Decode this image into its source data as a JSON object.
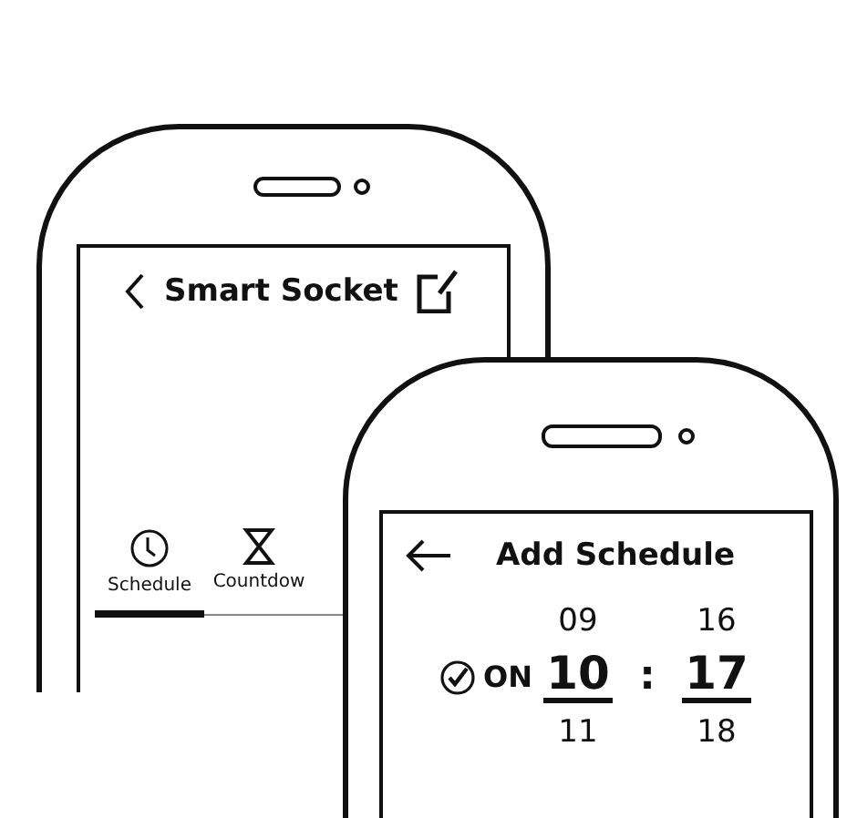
{
  "main_screen": {
    "title": "Smart Socket",
    "back_button": {
      "kind": "chevron"
    },
    "action_button": {
      "kind": "edit"
    },
    "tabs": [
      {
        "label": "Schedule",
        "kind": "clock",
        "selected": true
      },
      {
        "label": "Countdow",
        "kind": "hourglass",
        "selected": false
      }
    ]
  },
  "add_schedule_screen": {
    "title": "Add Schedule",
    "back_button": {
      "kind": "arrow"
    },
    "switch": {
      "label": "ON",
      "checked": true
    },
    "separator": ":",
    "columns": [
      {
        "above": "09",
        "value": "10",
        "below": "11"
      },
      {
        "above": "16",
        "value": "17",
        "below": "18"
      }
    ]
  }
}
